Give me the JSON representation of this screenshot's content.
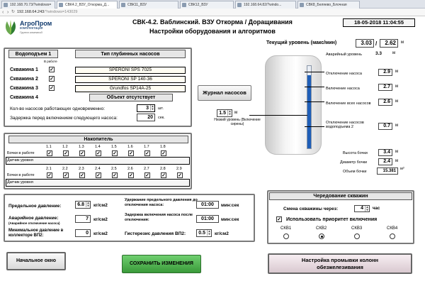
{
  "browser": {
    "tabs": [
      {
        "label": "192.168.70.73/?windows="
      },
      {
        "label": "СВК4.2_ВЗУ_Откорма_Д..."
      },
      {
        "label": "СВК11_ВЗУ"
      },
      {
        "label": "СВК12_ВЗУ"
      },
      {
        "label": "192.168.64.82/?windo..."
      },
      {
        "label": "СВК8_Беляево_Блочная"
      }
    ],
    "address_host": "192.168.64.243",
    "address_path": "/?windows=143029",
    "nav_icons": [
      "back-icon",
      "forward-icon",
      "reload-icon"
    ]
  },
  "header": {
    "logo_name": "АгроПром",
    "logo_sub": "комплектация",
    "logo_tag": "Группа компаний",
    "title_line1": "СВК-4.2. Ваблинский. ВЗУ Откорма / Доращивания",
    "title_line2": "Настройки оборудования и алгоритмов",
    "datetime": "18-05-2018 11:04:55"
  },
  "water_lift": {
    "title": "Водоподъем 1",
    "pump_type_title": "Тип глубинных насосов",
    "in_work_label": "В работе",
    "wells": [
      {
        "label": "Скважина 1",
        "checked": true,
        "pump": "SPERONI SPS 7025"
      },
      {
        "label": "Скважина 2",
        "checked": true,
        "pump": "SPERONI SP 140-36"
      },
      {
        "label": "Скважина 3",
        "checked": true,
        "pump": "Grundfos SP14A-25"
      },
      {
        "label": "Скважина 4",
        "checked": false,
        "pump": "Объект отсутствует"
      }
    ],
    "pumps_count_label": "Кол-во насосов работающих одновременно:",
    "pumps_count": "3",
    "pumps_count_unit": "шт.",
    "delay_label": "Задержка перед включением следующего насоса:",
    "delay": "20",
    "delay_unit": "сек."
  },
  "accumulator": {
    "title": "Накопитель",
    "row1_cols": [
      "1.1",
      "1.2",
      "1.3",
      "1.4",
      "1.5",
      "1.6",
      "1.7",
      "1.8"
    ],
    "row1_work": [
      true,
      true,
      true,
      true,
      true,
      true,
      true,
      true
    ],
    "row1_sensor": [
      false,
      false,
      false,
      false,
      false,
      false,
      false,
      true
    ],
    "row2_cols": [
      "2.1",
      "2.2",
      "2.3",
      "2.4",
      "2.5",
      "2.6",
      "2.7",
      "2.8",
      "2.9"
    ],
    "row2_work": [
      true,
      true,
      true,
      true,
      true,
      true,
      true,
      true,
      true
    ],
    "row2_sensor": [
      true,
      false,
      false,
      false,
      false,
      false,
      false,
      false,
      false
    ],
    "work_label": "Бочки в работе",
    "sensor_label": "Датчик уровня"
  },
  "tank": {
    "current_level_label": "Текущий уровень (макс/мин)",
    "current_level": "3.03",
    "max_level": "2.62",
    "unit_m": "м",
    "alarm_label": "Аварийный уровень",
    "alarm_value": "3.3",
    "pump_off_label": "Отключение насоса",
    "pump_off": "2.9",
    "pump_on_label": "Включение насоса",
    "pump_on": "2.7",
    "all_pumps_on_label": "Включение всех насосов",
    "all_pumps_on": "2.6",
    "pumps_off2_label": "Отключение насосов водоподъема 2",
    "pumps_off2": "0.7",
    "low_level_label": "Низкий уровень (Включение сирены)",
    "low_level": "1.5",
    "height_label": "Высота бочки",
    "height": "3.4",
    "diameter_label": "Диаметр бочки",
    "diameter": "2.4",
    "volume_label": "Объем бочки",
    "volume": "15.381",
    "volume_unit": "м³",
    "level_fraction": 0.89
  },
  "journal_button": "Журнал насосов",
  "pressure": {
    "limit_label": "Предельное давление:",
    "limit": "6.8",
    "alarm_label": "Аварийное давление:",
    "alarm_sub": "(Аварийное отключение насоса)",
    "alarm": "7",
    "min_label": "Минимальное давление в коллекторе ВП2:",
    "min": "0",
    "unit": "кг/см2",
    "hold_label": "Удержание предельного давления до отключения насоса:",
    "hold": "01:00",
    "delay_on_label": "Задержка включения насоса после отключения:",
    "delay_on": "01:00",
    "time_unit": "мин:сек",
    "hyst_label": "Гистерезис давления ВП2:",
    "hyst": "0.5"
  },
  "rotation": {
    "title": "Чередование скважин",
    "change_label": "Смена скважины через:",
    "change_value": "4",
    "change_unit": "час",
    "priority_label": "Использовать приоритет включения",
    "priority_checked": true,
    "wells": [
      "СКВ1",
      "СКВ2",
      "СКВ3",
      "СКВ4"
    ],
    "selected": 1
  },
  "buttons": {
    "home": "Начальное окно",
    "save": "СОХРАНИТЬ ИЗМЕНЕНИЯ",
    "wash": "Настройка промывки колонн обезжелезивания"
  },
  "colors": {
    "save_green": "#4bb04b",
    "tank_fill": "#1f5fb8",
    "logo_bg": "#123b6e"
  }
}
